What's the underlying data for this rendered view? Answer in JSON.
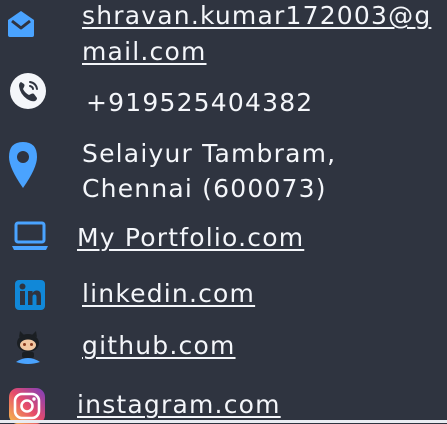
{
  "contacts": {
    "email": {
      "text": "shravan.kumar172003@gmail.com",
      "icon": "envelope-icon"
    },
    "phone": {
      "text": "+919525404382",
      "icon": "phone-icon"
    },
    "address": {
      "line1": "Selaiyur Tambram,",
      "line2": "Chennai (600073)",
      "icon": "map-pin-icon"
    },
    "portfolio": {
      "text": "My Portfolio.com",
      "icon": "laptop-icon"
    },
    "linkedin": {
      "text": "linkedin.com",
      "icon": "linkedin-icon"
    },
    "github": {
      "text": "github.com",
      "icon": "github-octocat-icon"
    },
    "instagram": {
      "text": "instagram.com",
      "icon": "instagram-icon"
    }
  },
  "colors": {
    "background": "#2f3440",
    "text": "#f4f6fa",
    "icon_blue": "#4aa3ff",
    "linkedin_blue": "#1188d8",
    "instagram_gradient": [
      "#f7c34b",
      "#e64b6b",
      "#7a3fbf"
    ]
  }
}
